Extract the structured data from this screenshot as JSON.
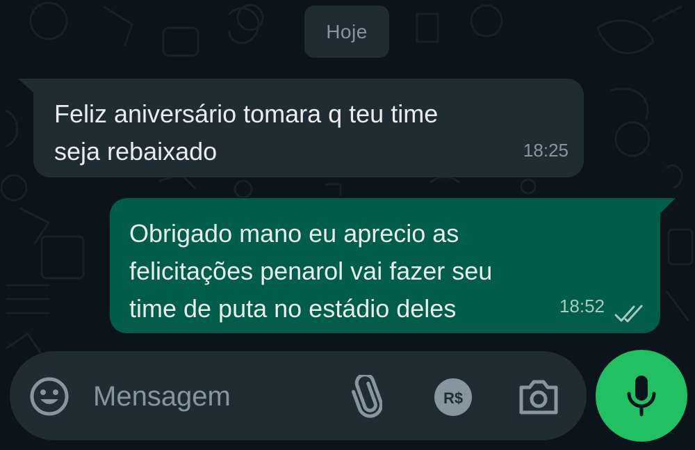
{
  "date_separator": "Hoje",
  "messages": [
    {
      "direction": "incoming",
      "text": "Feliz aniversário tomara q teu time\nseja rebaixado",
      "time": "18:25"
    },
    {
      "direction": "outgoing",
      "text": "Obrigado mano eu aprecio as\nfelicitações penarol vai fazer seu\ntime de puta no estádio deles",
      "time": "18:52",
      "status": "read"
    }
  ],
  "composer": {
    "placeholder": "Mensagem",
    "payment_label": "R$",
    "icons": [
      "emoji-icon",
      "attach-icon",
      "payment-icon",
      "camera-icon",
      "mic-icon"
    ]
  },
  "colors": {
    "background": "#0b141a",
    "incoming_bubble": "#1f2c34",
    "outgoing_bubble": "#005c4b",
    "accent": "#21c063",
    "secondary_text": "#8696a0"
  }
}
